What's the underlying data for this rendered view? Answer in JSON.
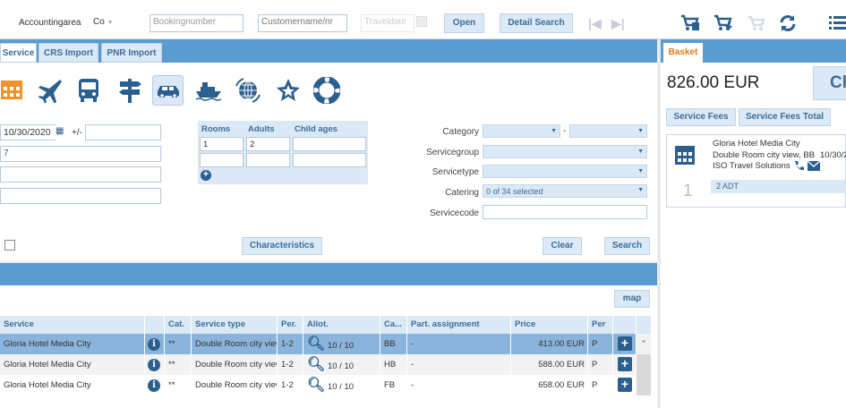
{
  "topbar": {
    "accountingarea_label": "Accountingarea",
    "accountingarea_value": "Co",
    "bookingnumber_placeholder": "Bookingnumber",
    "customername_placeholder": "Customername/nr",
    "traveldate_placeholder": "Traveldate",
    "open_label": "Open",
    "detail_search_label": "Detail Search"
  },
  "tabs": [
    "Service",
    "CRS Import",
    "PNR Import"
  ],
  "form": {
    "date_value": "10/30/2020",
    "plusminus_label": "+/-",
    "duration_prefix": "7",
    "rooms_header": "Rooms",
    "adults_header": "Adults",
    "childages_header": "Child ages",
    "rooms_value": "1",
    "adults_value": "2",
    "category_label": "Category",
    "category_dash": "-",
    "servicegroup_label": "Servicegroup",
    "servicetype_label": "Servicetype",
    "catering_label": "Catering",
    "catering_value": "0 of 34 selected",
    "servicecode_label": "Servicecode",
    "characteristics_label": "Characteristics",
    "clear_label": "Clear",
    "search_label": "Search"
  },
  "results": {
    "map_label": "map",
    "headers": [
      "Service",
      "Cat.",
      "Service type",
      "Per.",
      "Allot.",
      "Ca...",
      "Part. assignment",
      "Price",
      "Per"
    ],
    "rows": [
      {
        "service": "Gloria Hotel Media City",
        "cat": "**",
        "type": "Double Room city view",
        "per": "1-2",
        "allot": "10 / 10",
        "ca": "BB",
        "part": "-",
        "price": "413.00 EUR",
        "per2": "P"
      },
      {
        "service": "Gloria Hotel Media City",
        "cat": "**",
        "type": "Double Room city view",
        "per": "1-2",
        "allot": "10 / 10",
        "ca": "HB",
        "part": "-",
        "price": "588.00 EUR",
        "per2": "P"
      },
      {
        "service": "Gloria Hotel Media City",
        "cat": "**",
        "type": "Double Room city view",
        "per": "1-2",
        "allot": "10 / 10",
        "ca": "FB",
        "part": "-",
        "price": "658.00 EUR",
        "per2": "P"
      }
    ]
  },
  "basket": {
    "tab_label": "Basket",
    "total": "826.00 EUR",
    "checkout_label": "Ch",
    "service_fees_label": "Service Fees",
    "service_fees_total_label": "Service Fees Total",
    "item_title": "Gloria Hotel Media City",
    "item_room": "Double Room city view, BB",
    "item_date": "10/30/2",
    "item_operator": "ISO Travel Solutions",
    "item_number": "1",
    "item_pax": "2 ADT"
  },
  "colors": {
    "accent": "#5a9bd0",
    "dark": "#2b5f8e",
    "light": "#dbe8f5",
    "selected": "#8ab4db"
  }
}
